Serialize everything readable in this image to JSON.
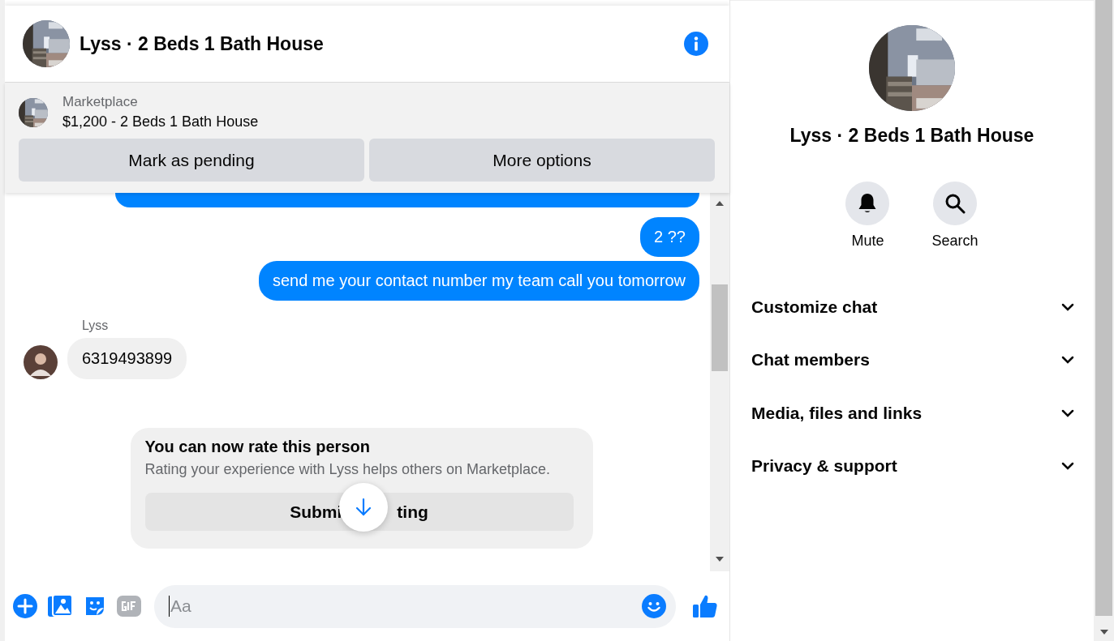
{
  "chat": {
    "title": "Lyss · 2 Beds 1 Bath House",
    "listing": {
      "source": "Marketplace",
      "title": "$1,200 - 2 Beds 1 Bath House",
      "actions": [
        "Mark as pending",
        "More options"
      ]
    },
    "messages": [
      {
        "kind": "cut",
        "sent": true
      },
      {
        "kind": "text",
        "sent": true,
        "text": "2 ??"
      },
      {
        "kind": "text",
        "sent": true,
        "text": "send me your contact number my team call you tomorrow"
      },
      {
        "kind": "text",
        "sent": false,
        "sender": "Lyss",
        "text": "6319493899"
      }
    ],
    "rating_card": {
      "title": "You can now rate this person",
      "body": "Rating your experience with Lyss helps others on Marketplace.",
      "button_visible_parts": [
        "Submi",
        "ting"
      ]
    },
    "composer": {
      "placeholder": "Aa"
    }
  },
  "details": {
    "title": "Lyss · 2 Beds 1 Bath House",
    "actions": [
      {
        "kind": "mute",
        "label": "Mute"
      },
      {
        "kind": "search",
        "label": "Search"
      }
    ],
    "sections": [
      {
        "label": "Customize chat",
        "expanded": false
      },
      {
        "label": "Chat members",
        "expanded": false
      },
      {
        "label": "Media, files and links",
        "expanded": false
      },
      {
        "label": "Privacy & support",
        "expanded": false
      }
    ]
  }
}
